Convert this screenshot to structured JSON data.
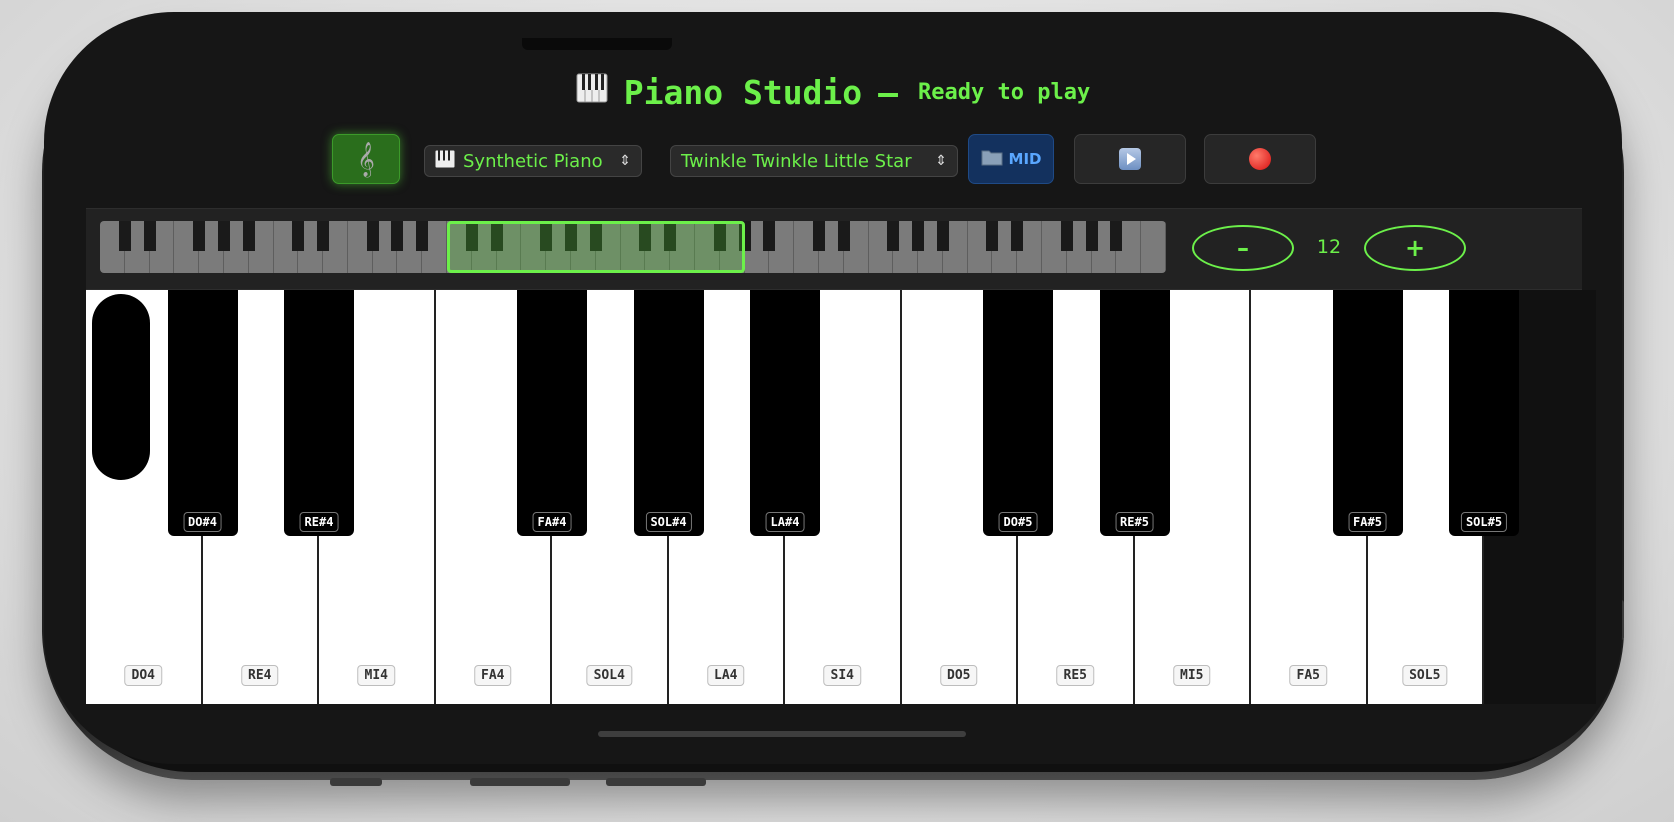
{
  "header": {
    "icon": "piano-keyboard-icon",
    "title": "Piano Studio",
    "separator": "–",
    "status": "Ready to play"
  },
  "toolbar": {
    "music_button_icon": "treble-clef-icon",
    "instrument": {
      "icon": "piano-keyboard-icon",
      "value": "Synthetic Piano"
    },
    "song": {
      "value": "Twinkle Twinkle Little Star"
    },
    "midi_button": {
      "icon": "folder-icon",
      "label": "MID"
    },
    "play_button_icon": "play-icon",
    "record_button_icon": "record-icon"
  },
  "octave": {
    "minus_label": "–",
    "plus_label": "+",
    "value": "12"
  },
  "keys": {
    "white": [
      "DO4",
      "RE4",
      "MI4",
      "FA4",
      "SOL4",
      "LA4",
      "SI4",
      "DO5",
      "RE5",
      "MI5",
      "FA5",
      "SOL5"
    ],
    "black": [
      "DO#4",
      "RE#4",
      "FA#4",
      "SOL#4",
      "LA#4",
      "DO#5",
      "RE#5",
      "FA#5",
      "SOL#5"
    ]
  },
  "colors": {
    "accent": "#6cf04a",
    "background": "#161616",
    "midi_button": "#13315e"
  }
}
